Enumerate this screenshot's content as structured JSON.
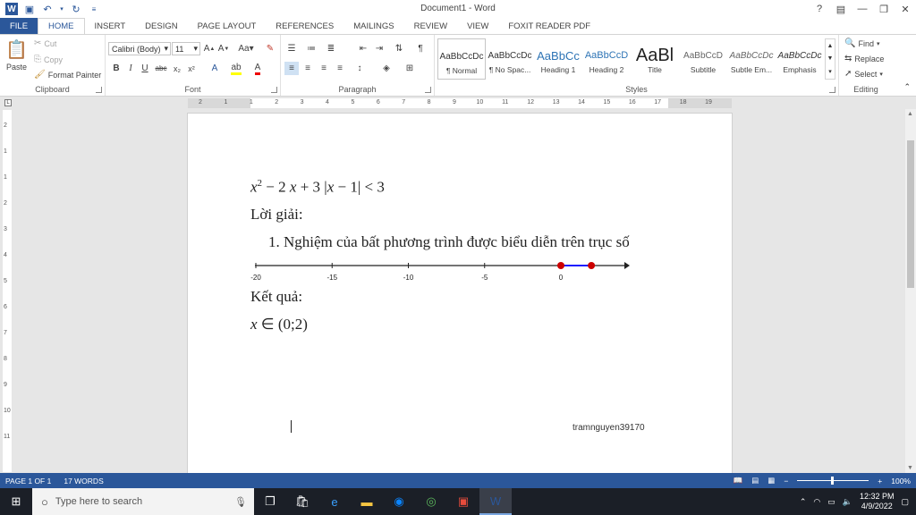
{
  "window": {
    "title": "Document1 - Word",
    "help": "?",
    "minimize": "—",
    "restore": "❐",
    "close": "✕"
  },
  "quick_access": {
    "logo": "W",
    "save_icon": "save-icon",
    "undo_icon": "undo-icon",
    "redo_icon": "redo-icon",
    "customize_icon": "customize-icon"
  },
  "tabs": [
    "HOME",
    "INSERT",
    "DESIGN",
    "PAGE LAYOUT",
    "REFERENCES",
    "MAILINGS",
    "REVIEW",
    "VIEW",
    "FOXIT READER PDF"
  ],
  "file_tab": "FILE",
  "clipboard": {
    "paste": "Paste",
    "cut": "Cut",
    "copy": "Copy",
    "format_painter": "Format Painter",
    "label": "Clipboard"
  },
  "font": {
    "name": "Calibri (Body)",
    "size": "11",
    "label": "Font"
  },
  "paragraph": {
    "label": "Paragraph"
  },
  "styles": {
    "items": [
      {
        "preview": "AaBbCcDc",
        "name": "¶ Normal"
      },
      {
        "preview": "AaBbCcDc",
        "name": "¶ No Spac..."
      },
      {
        "preview": "AaBbCc",
        "name": "Heading 1"
      },
      {
        "preview": "AaBbCcD",
        "name": "Heading 2"
      },
      {
        "preview": "AaBl",
        "name": "Title"
      },
      {
        "preview": "AaBbCcD",
        "name": "Subtitle"
      },
      {
        "preview": "AaBbCcDc",
        "name": "Subtle Em..."
      },
      {
        "preview": "AaBbCcDc",
        "name": "Emphasis"
      }
    ],
    "label": "Styles"
  },
  "editing": {
    "find": "Find",
    "replace": "Replace",
    "select": "Select",
    "label": "Editing"
  },
  "ruler": {
    "numbers": [
      "2",
      "1",
      "1",
      "2",
      "3",
      "4",
      "5",
      "6",
      "7",
      "8",
      "9",
      "10",
      "11",
      "12",
      "13",
      "14",
      "15",
      "16",
      "17",
      "18",
      "19"
    ]
  },
  "vruler": {
    "numbers": [
      "2",
      "1",
      "1",
      "2",
      "3",
      "4",
      "5",
      "6",
      "7",
      "8",
      "9",
      "10",
      "11"
    ]
  },
  "document": {
    "line1": {
      "x": "x",
      "exp": "2",
      "rest": " − 2 ",
      "x2": "x",
      "rest2": " + 3 |",
      "x3": "x",
      "rest3": " − 1| < 3"
    },
    "line2": "Lời giải:",
    "line3": "1. Nghiệm của bất phương trình được biểu diễn trên trục số",
    "numberline": {
      "ticks": [
        "-20",
        "-15",
        "-10",
        "-5",
        "0"
      ],
      "interval_start": 0,
      "interval_end": 2
    },
    "line4": "Kết quả:",
    "line5": {
      "x": "x",
      "rest": " ∈ (0;2)"
    },
    "watermark": "tramnguyen39170"
  },
  "status": {
    "page": "PAGE 1 OF 1",
    "words": "17 WORDS",
    "zoom": "100%"
  },
  "taskbar": {
    "search_placeholder": "Type here to search",
    "time": "12:32 PM",
    "date": "4/9/2022"
  },
  "colors": {
    "brand": "#2b579a",
    "point": "#cc0000",
    "segment": "#1a1aff"
  }
}
